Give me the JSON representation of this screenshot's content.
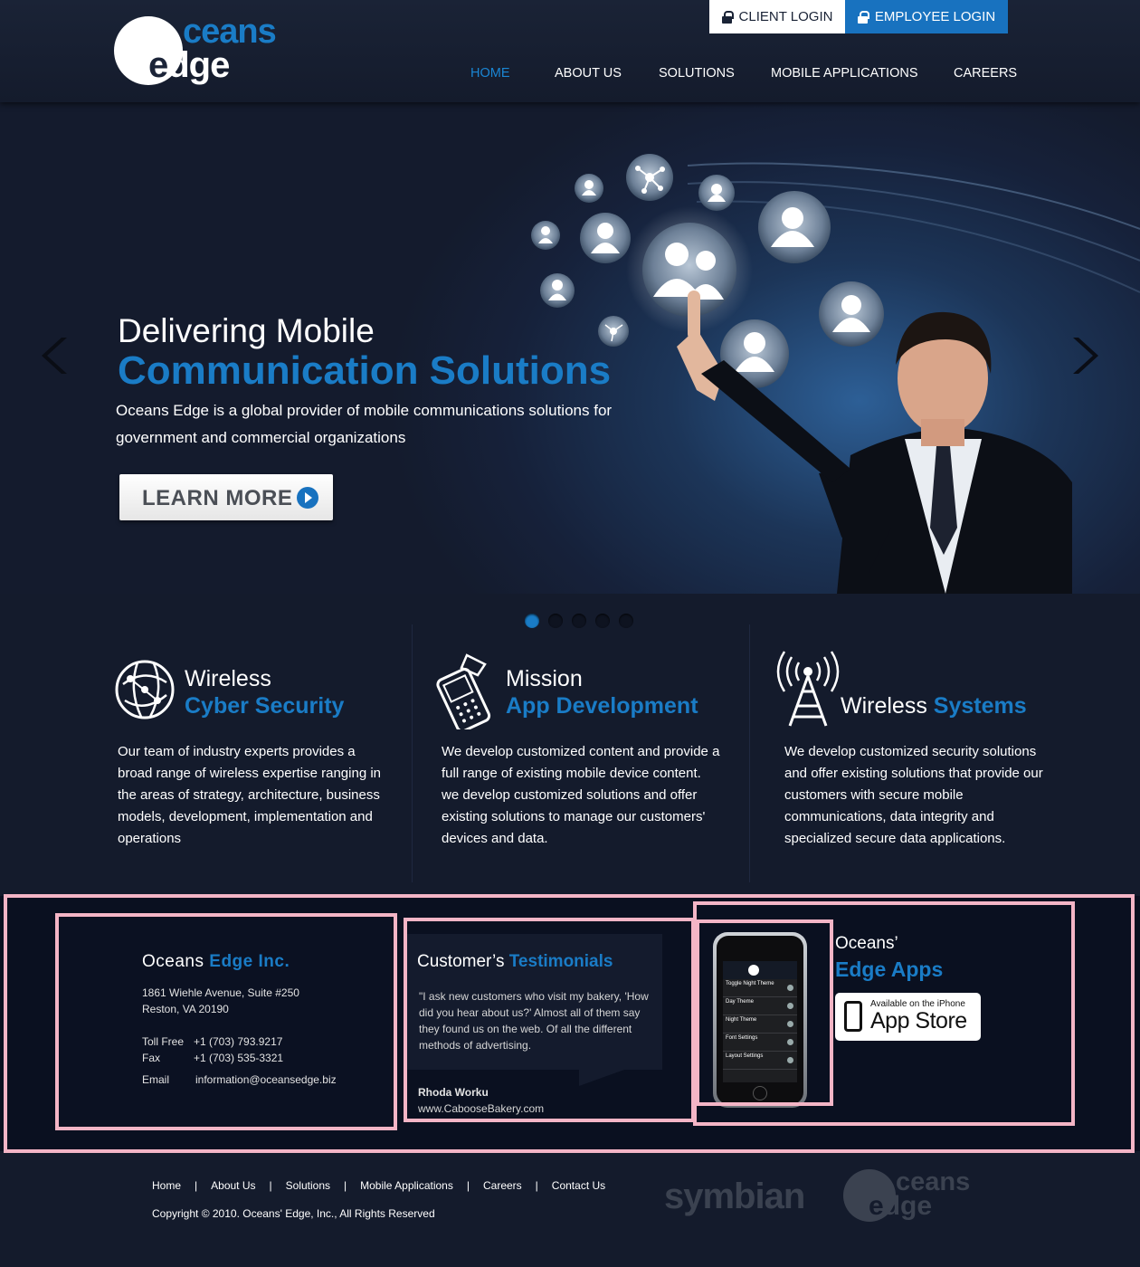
{
  "brand": {
    "logo_oceans": "ceans",
    "logo_e": "e",
    "logo_dge": "dge"
  },
  "login": {
    "client": "CLIENT  LOGIN",
    "employee": "EMPLOYEE LOGIN"
  },
  "nav": [
    "HOME",
    "ABOUT US",
    "SOLUTIONS",
    "MOBILE APPLICATIONS",
    "CAREERS"
  ],
  "hero": {
    "title_line1": "Delivering Mobile",
    "title_line2": "Communication Solutions",
    "description": "Oceans Edge is a global provider of mobile communications solutions for government and commercial organizations",
    "button": "LEARN MORE"
  },
  "slider": {
    "count": 5,
    "active_index": 0
  },
  "features": [
    {
      "title1": "Wireless",
      "title2": "Cyber Security",
      "icon": "globe-network-icon",
      "text": "Our team of industry experts provides a broad range of wireless expertise ranging in the areas of strategy, architecture, business models, development, implementation and operations"
    },
    {
      "title1": "Mission",
      "title2": "App Development",
      "icon": "mobile-phone-icon",
      "text": "We develop customized content and provide a full range of existing mobile device content. we develop customized solutions and offer existing solutions to manage our customers' devices and data."
    },
    {
      "title1": "Wireless",
      "title2": "Systems",
      "icon": "antenna-tower-icon",
      "text": "We develop customized security solutions and offer existing solutions that provide our customers with secure mobile communications, data integrity and specialized secure data applications."
    }
  ],
  "contact": {
    "title1": "Oceans",
    "title2": "Edge Inc.",
    "address1": "1861 Wiehle Avenue, Suite #250",
    "address2": "Reston, VA 20190",
    "tollfree_label": "Toll Free",
    "tollfree": "+1  (703) 793.9217",
    "fax_label": "Fax",
    "fax": "+1 (703) 535-3321",
    "email_label": "Email",
    "email": "information@oceansedge.biz"
  },
  "testimonial": {
    "title1": "Customer’s",
    "title2": "Testimonials",
    "quote": "\"I ask new customers who visit my bakery, 'How did you hear about us?' Almost all of them say they found us on the web. Of all the different methods of advertising.",
    "author": "Rhoda Worku",
    "url": "www.CabooseBakery.com"
  },
  "apps": {
    "title1": "Oceans’",
    "title2": "Edge Apps",
    "appstore_small": "Available on the iPhone",
    "appstore_big": "App Store",
    "phone_rows": [
      "Toggle Night Theme",
      "Day Theme",
      "Night Theme",
      "Font Settings",
      "Layout Settings"
    ]
  },
  "footer": {
    "links": [
      "Home",
      "About Us",
      "Solutions",
      "Mobile Applications",
      "Careers",
      "Contact Us"
    ],
    "copyright": "Copyright © 2010. Oceans' Edge, Inc., All Rights Reserved",
    "symbian": "symbian"
  },
  "colors": {
    "accent": "#1a7cc6",
    "background": "#141b2c",
    "band": "#0a1020",
    "highlight_box": "#f4b5c6"
  }
}
